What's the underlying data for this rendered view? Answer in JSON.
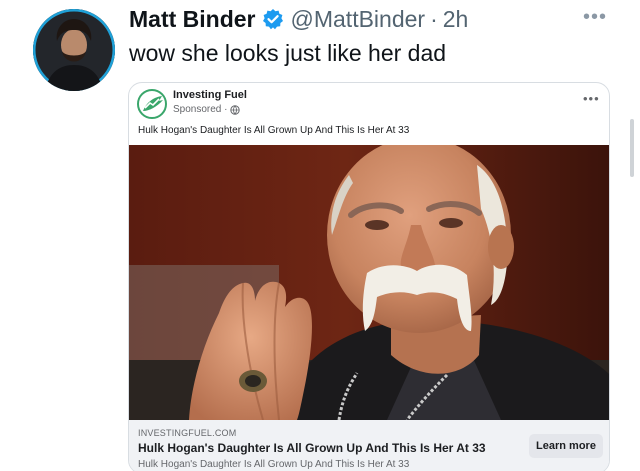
{
  "tweet": {
    "author_name": "Matt Binder",
    "handle": "@MattBinder",
    "separator": "·",
    "time": "2h",
    "text": "wow she looks just like her dad",
    "more_glyph": "•••"
  },
  "ad": {
    "advertiser": "Investing Fuel",
    "sponsored_label": "Sponsored ·",
    "more_glyph": "•••",
    "caption": "Hulk Hogan's Daughter Is All Grown Up And This Is Her At 33",
    "link": {
      "domain": "INVESTINGFUEL.COM",
      "title": "Hulk Hogan's Daughter Is All Grown Up And This Is Her At 33",
      "description": "Hulk Hogan's Daughter Is All Grown Up And This Is Her At 33",
      "cta_label": "Learn more"
    }
  },
  "colors": {
    "verified_blue": "#1d9bf0",
    "logo_green": "#3aa66b",
    "avatar_ring": "#1fa1d8"
  }
}
